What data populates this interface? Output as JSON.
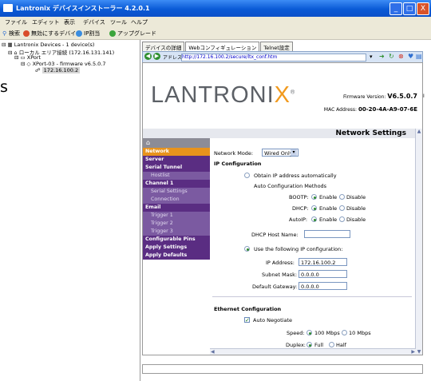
{
  "window": {
    "title": "Lantronix デバイスインストーラー 4.2.0.1",
    "controls": {
      "minimize": "_",
      "maximize": "□",
      "close": "X"
    }
  },
  "menu": [
    "ファイル",
    "エディット",
    "表示",
    "デバイス",
    "ツール",
    "ヘルプ"
  ],
  "toolbar": [
    "検索",
    "無効にするデバイス",
    "IP割当",
    "アップグレード"
  ],
  "tree": {
    "root": "Lantronix Devices - 1 device(s)",
    "network": "ローカル エリア接続 (172.16.131.141)",
    "group": "XPort",
    "device": "XPort-03 - firmware v6.5.0.7",
    "host": "172.16.100.2"
  },
  "outside": {
    "left_letter": "s",
    "right_letter": "I"
  },
  "tabs": [
    "デバイスの詳細",
    "Webコンフィギュレーション",
    "Telnet設定"
  ],
  "address_bar": {
    "label": "アドレス",
    "url": "http://172.16.100.2/secure/ltx_conf.htm"
  },
  "header": {
    "logo_main": "LANTRONI",
    "logo_x": "X",
    "logo_reg": "®",
    "firmware_label": "Firmware Version:",
    "firmware_value": "V6.5.0.7",
    "mac_label": "MAC Address:",
    "mac_value": "00-20-4A-A9-07-6E",
    "section_title": "Network Settings"
  },
  "nav": {
    "home": "⌂",
    "items": [
      {
        "label": "Network",
        "type": "main"
      },
      {
        "label": "Server",
        "type": "main"
      },
      {
        "label": "Serial Tunnel",
        "type": "main"
      },
      {
        "label": "Hostlist",
        "type": "sub"
      },
      {
        "label": "Channel 1",
        "type": "main"
      },
      {
        "label": "Serial Settings",
        "type": "sub"
      },
      {
        "label": "Connection",
        "type": "sub"
      },
      {
        "label": "Email",
        "type": "main"
      },
      {
        "label": "Trigger 1",
        "type": "sub"
      },
      {
        "label": "Trigger 2",
        "type": "sub"
      },
      {
        "label": "Trigger 3",
        "type": "sub"
      },
      {
        "label": "Configurable Pins",
        "type": "main"
      },
      {
        "label": "Apply Settings",
        "type": "main"
      },
      {
        "label": "Apply Defaults",
        "type": "main"
      }
    ]
  },
  "form": {
    "network_mode_label": "Network Mode:",
    "network_mode_value": "Wired Only",
    "ip_config_heading": "IP Configuration",
    "obtain_auto_label": "Obtain IP address automatically",
    "auto_methods_heading": "Auto Configuration Methods",
    "bootp_label": "BOOTP:",
    "dhcp_label": "DHCP:",
    "autoip_label": "AutoIP:",
    "enable_label": "Enable",
    "disable_label": "Disable",
    "dhcp_host_label": "DHCP Host Name:",
    "dhcp_host_value": "",
    "use_following_label": "Use the following IP configuration:",
    "ip_address_label": "IP Address:",
    "ip_address_value": "172.16.100.2",
    "subnet_label": "Subnet Mask:",
    "subnet_value": "0.0.0.0",
    "gateway_label": "Default Gateway:",
    "gateway_value": "0.0.0.0",
    "ethernet_heading": "Ethernet Configuration",
    "auto_negotiate_label": "Auto Negotiate",
    "speed_label": "Speed:",
    "speed_100": "100 Mbps",
    "speed_10": "10 Mbps",
    "duplex_label": "Duplex:",
    "duplex_full": "Full",
    "duplex_half": "Half"
  }
}
